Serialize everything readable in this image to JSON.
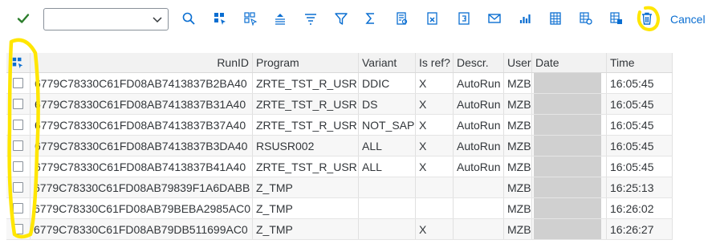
{
  "toolbar": {
    "select_value": "",
    "cancel_label": "Cancel",
    "icons": [
      "check-icon",
      "dropdown-chevron-icon",
      "zoom-icon",
      "select-all-icon",
      "deselect-all-icon",
      "sort-ascending-icon",
      "sort-descending-icon",
      "filter-icon",
      "sum-icon",
      "subtotal-icon",
      "export-icon",
      "print-preview-icon",
      "mail-icon",
      "chart-icon",
      "layout-icon",
      "settings-icon",
      "details-icon",
      "trash-icon"
    ]
  },
  "table": {
    "headers": {
      "runid": "RunID",
      "program": "Program",
      "variant": "Variant",
      "isref": "Is ref?",
      "descr": "Descr.",
      "user": "User",
      "date": "Date",
      "time": "Time"
    },
    "rows": [
      {
        "runid": "6779C78330C61FD08AB7413837B2BA40",
        "program": "ZRTE_TST_R_USR",
        "variant": "DDIC",
        "isref": "X",
        "descr": "AutoRun",
        "user": "MZB",
        "date": "",
        "time": "16:05:45"
      },
      {
        "runid": "6779C78330C61FD08AB7413837B31A40",
        "program": "ZRTE_TST_R_USR",
        "variant": "DS",
        "isref": "X",
        "descr": "AutoRun",
        "user": "MZB",
        "date": "",
        "time": "16:05:45"
      },
      {
        "runid": "6779C78330C61FD08AB7413837B37A40",
        "program": "ZRTE_TST_R_USR",
        "variant": "NOT_SAP",
        "isref": "X",
        "descr": "AutoRun",
        "user": "MZB",
        "date": "",
        "time": "16:05:45"
      },
      {
        "runid": "6779C78330C61FD08AB7413837B3DA40",
        "program": "RSUSR002",
        "variant": "ALL",
        "isref": "X",
        "descr": "AutoRun",
        "user": "MZB",
        "date": "",
        "time": "16:05:45"
      },
      {
        "runid": "6779C78330C61FD08AB7413837B41A40",
        "program": "ZRTE_TST_R_USR",
        "variant": "ALL",
        "isref": "X",
        "descr": "AutoRun",
        "user": "MZB",
        "date": "",
        "time": "16:05:45"
      },
      {
        "runid": "6779C78330C61FD08AB79839F1A6DABB",
        "program": "Z_TMP",
        "variant": "",
        "isref": "",
        "descr": "",
        "user": "MZB",
        "date": "",
        "time": "16:25:13"
      },
      {
        "runid": "6779C78330C61FD08AB79BEBA2985AC0",
        "program": "Z_TMP",
        "variant": "",
        "isref": "",
        "descr": "",
        "user": "MZB",
        "date": "",
        "time": "16:26:02"
      },
      {
        "runid": "6779C78330C61FD08AB79DB511699AC0",
        "program": "Z_TMP",
        "variant": "",
        "isref": "X",
        "descr": "",
        "user": "MZB",
        "date": "",
        "time": "16:26:27"
      }
    ]
  },
  "colors": {
    "accent": "#0a6ed1",
    "confirm": "#2b7d2b",
    "annotation": "#ffe600"
  }
}
